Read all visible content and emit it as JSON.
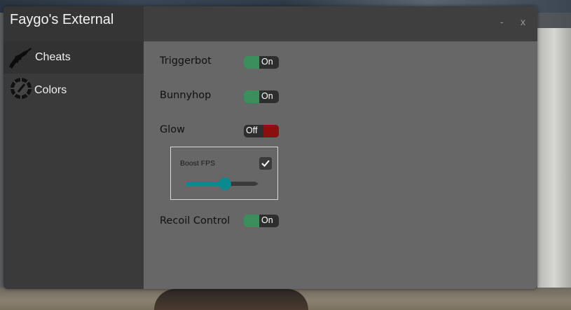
{
  "window": {
    "title": "Faygo's External",
    "minimize_label": "-",
    "close_label": "x"
  },
  "sidebar": {
    "items": [
      {
        "label": "Cheats",
        "icon": "rifle-icon",
        "active": true
      },
      {
        "label": "Colors",
        "icon": "color-wheel-icon",
        "active": false
      }
    ]
  },
  "options": {
    "triggerbot": {
      "label": "Triggerbot",
      "state": "On"
    },
    "bunnyhop": {
      "label": "Bunnyhop",
      "state": "On"
    },
    "glow": {
      "label": "Glow",
      "state": "Off"
    },
    "boost_fps": {
      "label": "Boost FPS",
      "checked": true,
      "slider_value": 0.56
    },
    "recoil_control": {
      "label": "Recoil Control",
      "state": "On"
    }
  },
  "colors": {
    "toggle_on": "#3b8f5c",
    "toggle_off": "#8a0f0f",
    "slider_accent": "#0a8a8f"
  }
}
